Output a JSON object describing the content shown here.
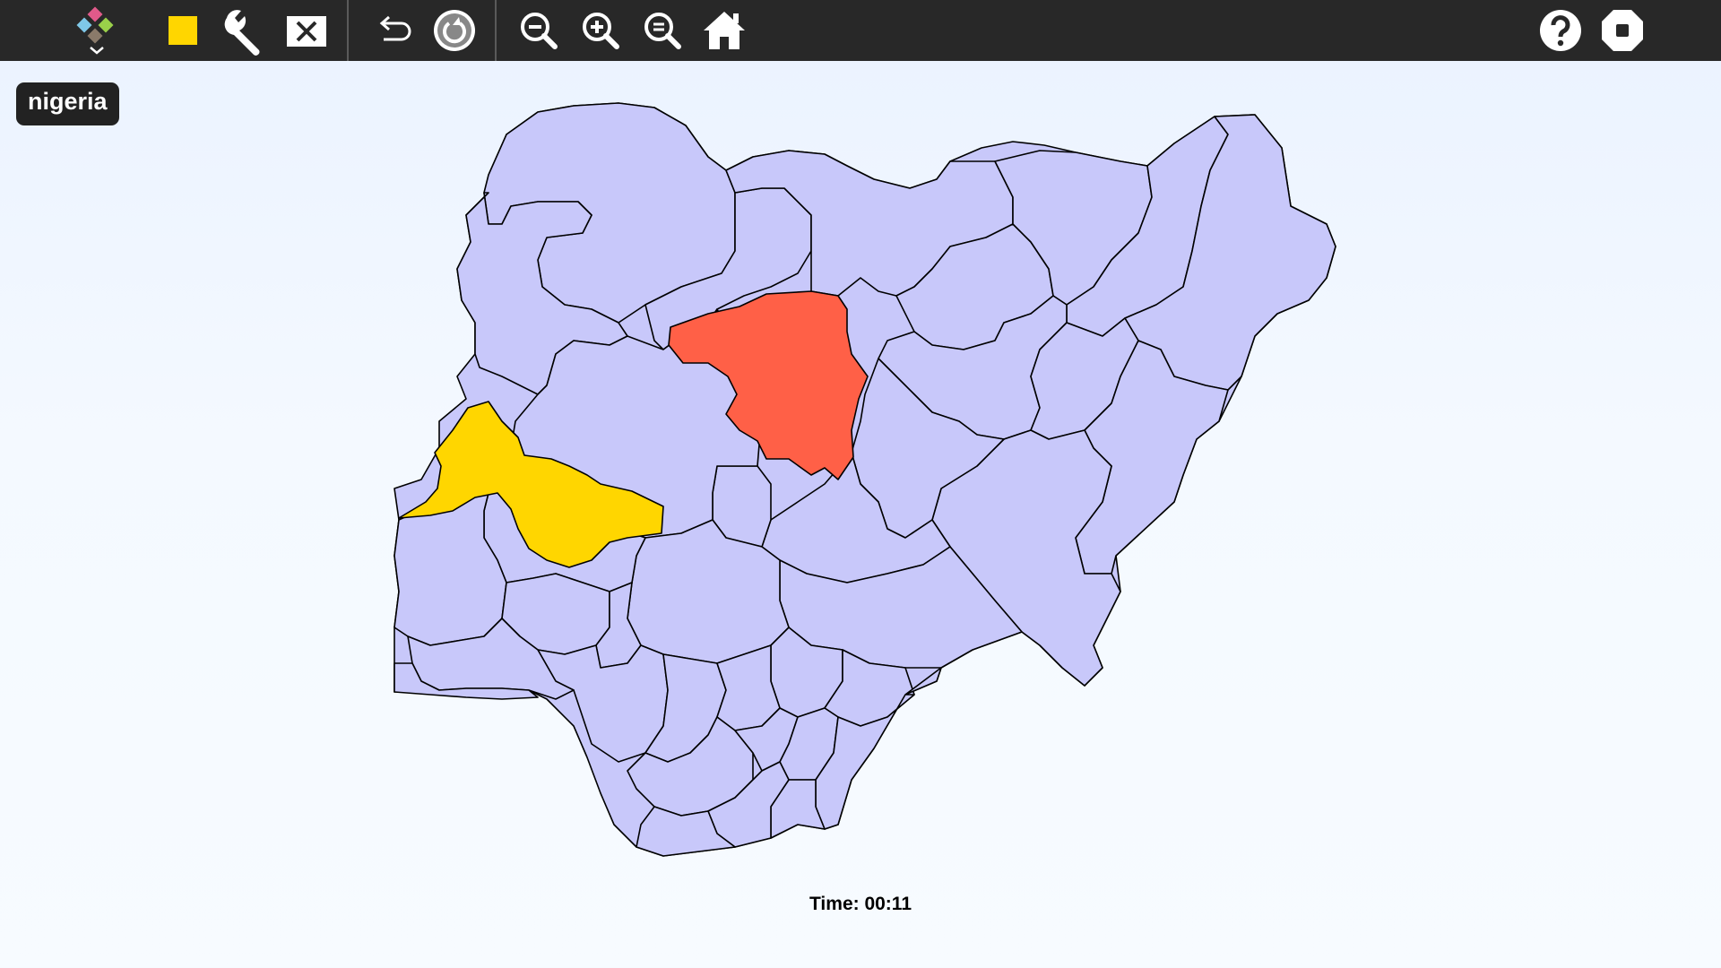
{
  "toolbar": {
    "left_buttons": [
      {
        "name": "activity-menu",
        "icon": "activity-logo-icon"
      },
      {
        "name": "color",
        "icon": "yellow-square-icon",
        "color": "#ffd600"
      },
      {
        "name": "tools",
        "icon": "wrench-icon"
      },
      {
        "name": "clear",
        "icon": "close-box-icon"
      },
      {
        "name": "undo",
        "icon": "undo-icon"
      },
      {
        "name": "restart",
        "icon": "restart-icon"
      },
      {
        "name": "zoom-out",
        "icon": "zoom-out-icon"
      },
      {
        "name": "zoom-in",
        "icon": "zoom-in-icon"
      },
      {
        "name": "zoom-fit",
        "icon": "zoom-fit-icon"
      },
      {
        "name": "home",
        "icon": "home-icon"
      }
    ],
    "right_buttons": [
      {
        "name": "help",
        "icon": "help-icon"
      },
      {
        "name": "stop",
        "icon": "stop-icon"
      }
    ]
  },
  "map": {
    "title": "nigeria",
    "colors": {
      "region_default": "#c8c8fa",
      "region_highlight_red": "#ff6047",
      "region_highlight_yellow": "#ffd600",
      "stroke": "#000000"
    }
  },
  "status": {
    "timer": "Time: 00:11"
  }
}
